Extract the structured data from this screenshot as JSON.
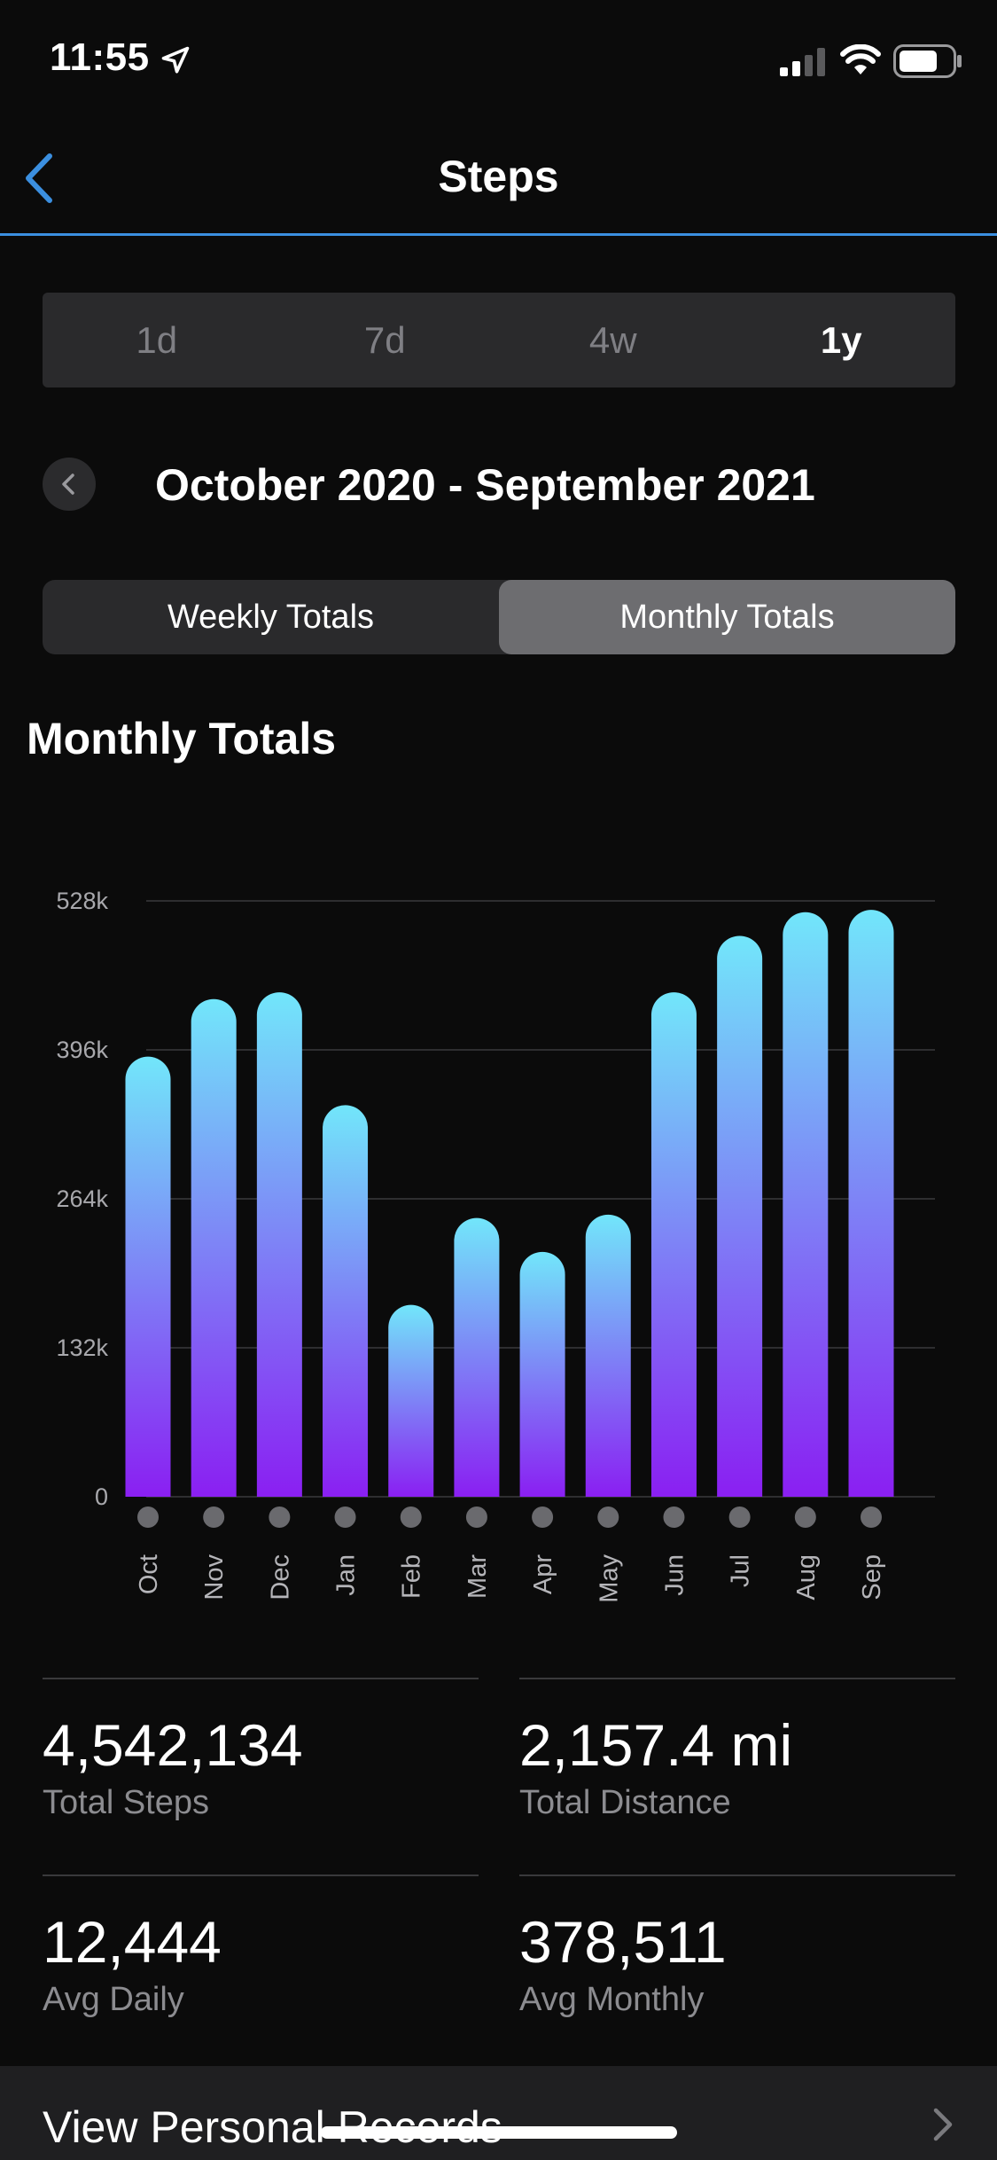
{
  "status": {
    "time": "11:55"
  },
  "nav": {
    "title": "Steps"
  },
  "periods": [
    {
      "label": "1d",
      "active": false
    },
    {
      "label": "7d",
      "active": false
    },
    {
      "label": "4w",
      "active": false
    },
    {
      "label": "1y",
      "active": true
    }
  ],
  "range": {
    "title": "October 2020 - September 2021"
  },
  "totals_toggle": {
    "weekly": "Weekly Totals",
    "monthly": "Monthly Totals",
    "active": "monthly"
  },
  "section": {
    "title": "Monthly Totals"
  },
  "colors": {
    "accent": "#3b8fe0",
    "bar_top": "#72e6fa",
    "bar_bottom": "#8a1ff2"
  },
  "chart_data": {
    "type": "bar",
    "categories": [
      "Oct",
      "Nov",
      "Dec",
      "Jan",
      "Feb",
      "Mar",
      "Apr",
      "May",
      "Jun",
      "Jul",
      "Aug",
      "Sep"
    ],
    "values": [
      390000,
      441000,
      447000,
      347000,
      170000,
      247000,
      217000,
      250000,
      447000,
      497000,
      518000,
      520000
    ],
    "y_ticks": [
      "0",
      "132k",
      "264k",
      "396k",
      "528k"
    ],
    "ylim": [
      0,
      528000
    ],
    "grid": true
  },
  "stats": [
    {
      "value": "4,542,134",
      "label": "Total Steps"
    },
    {
      "value": "2,157.4 mi",
      "label": "Total Distance"
    },
    {
      "value": "12,444",
      "label": "Avg Daily"
    },
    {
      "value": "378,511",
      "label": "Avg Monthly"
    }
  ],
  "records": {
    "label": "View Personal Records"
  }
}
